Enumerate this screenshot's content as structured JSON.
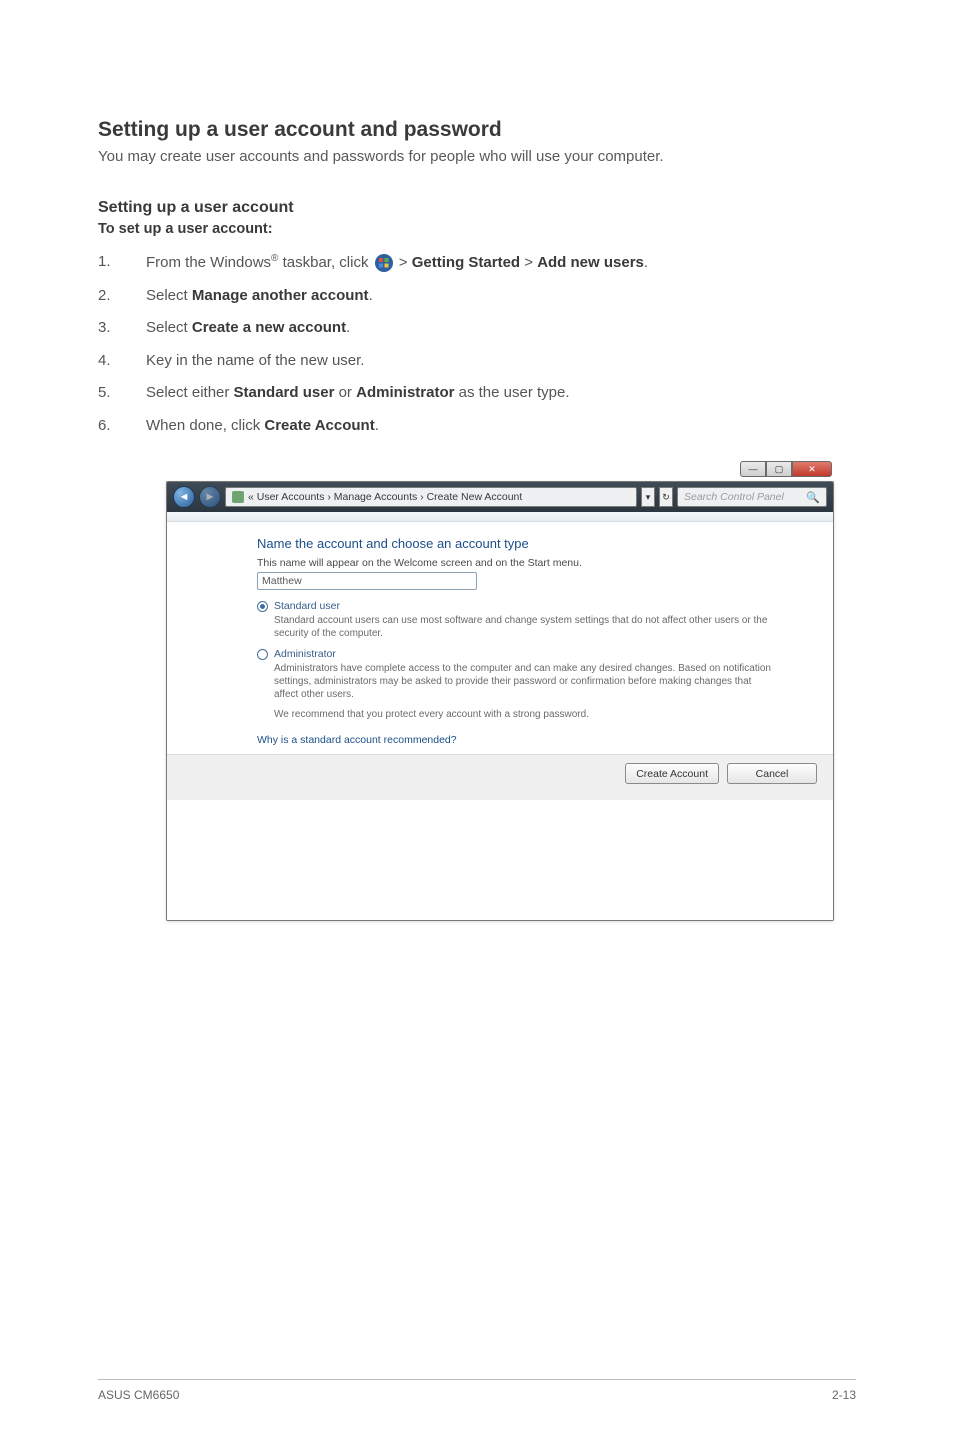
{
  "heading": "Setting up a user account and password",
  "intro": "You may create user accounts and passwords for people who will use your computer.",
  "sub_heading": "Setting up a user account",
  "instruction_lead": "To set up a user account:",
  "steps": {
    "s1": {
      "num": "1.",
      "pre": "From the Windows",
      "reg": "®",
      "mid": " taskbar, click ",
      "post": " > ",
      "b1": "Getting Started",
      "sep": " > ",
      "b2": "Add new users",
      "end": "."
    },
    "s2": {
      "num": "2.",
      "pre": "Select ",
      "b": "Manage another account",
      "end": "."
    },
    "s3": {
      "num": "3.",
      "pre": "Select ",
      "b": "Create a new account",
      "end": "."
    },
    "s4": {
      "num": "4.",
      "text": "Key in the name of the new user."
    },
    "s5": {
      "num": "5.",
      "pre": "Select either ",
      "b1": "Standard user",
      "mid": " or ",
      "b2": "Administrator",
      "post": " as the user type."
    },
    "s6": {
      "num": "6.",
      "pre": "When done, click ",
      "b": "Create Account",
      "end": "."
    }
  },
  "window": {
    "search_placeholder": "Search Control Panel",
    "breadcrumb": "« User Accounts  ›  Manage Accounts  ›  Create New Account",
    "title": "Name the account and choose an account type",
    "subtitle": "This name will appear on the Welcome screen and on the Start menu.",
    "name_value": "Matthew",
    "std_label": "Standard user",
    "std_desc": "Standard account users can use most software and change system settings that do not affect other users or the security of the computer.",
    "admin_label": "Administrator",
    "admin_desc": "Administrators have complete access to the computer and can make any desired changes. Based on notification settings, administrators may be asked to provide their password or confirmation before making changes that affect other users.",
    "reco": "We recommend that you protect every account with a strong password.",
    "link": "Why is a standard account recommended?",
    "btn_create": "Create Account",
    "btn_cancel": "Cancel"
  },
  "footer": {
    "left": "ASUS CM6650",
    "right": "2-13"
  }
}
